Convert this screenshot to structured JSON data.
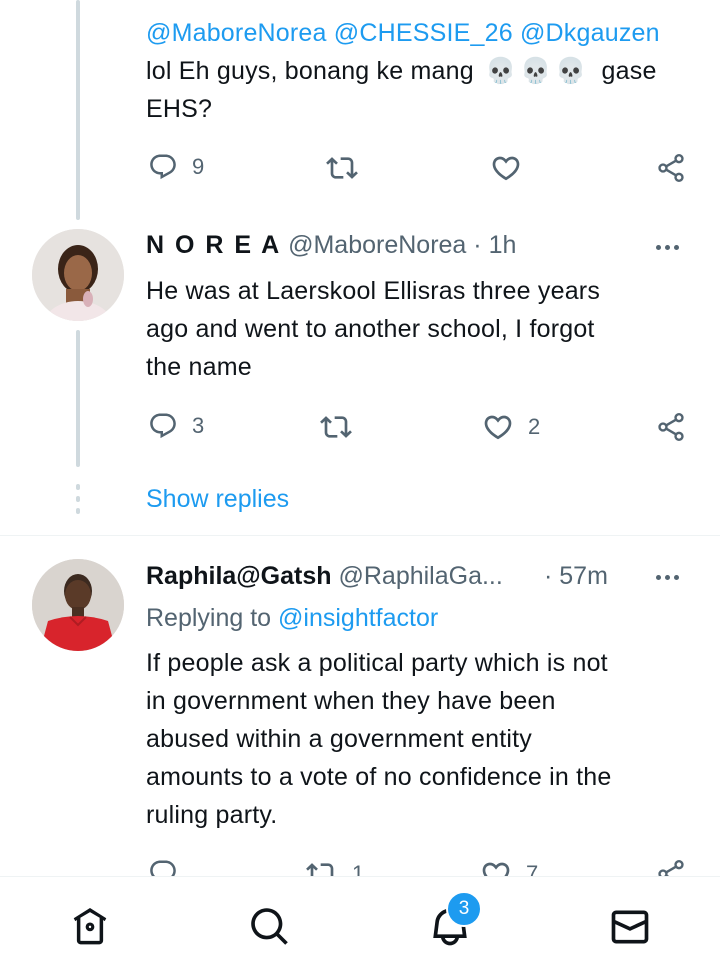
{
  "tweet1": {
    "mentions": "@MaboreNorea @CHESSIE_26 @Dkgauzen",
    "text_before": "lol Eh guys, bonang ke mang",
    "emojis": "💀💀💀",
    "text_after": "gase",
    "text_line3": "EHS?",
    "reply_count": "9"
  },
  "tweet2": {
    "display_name": "N O R E A",
    "handle": "@MaboreNorea",
    "time": "· 1h",
    "text_lines": [
      "He was at Laerskool Ellisras three years",
      "ago and went to another school, I forgot",
      "the name"
    ],
    "reply_count": "3",
    "like_count": "2"
  },
  "show_replies": "Show replies",
  "tweet3": {
    "display_name": "Raphila@Gatsh",
    "handle": "@RaphilaGa...",
    "time": "· 57m",
    "replying_prefix": "Replying to",
    "replying_to": "@insightfactor",
    "text_lines": [
      "If people ask a political party which is not",
      "in government when they have been",
      "abused within a government entity",
      "amounts to a vote of no confidence in the",
      "ruling party."
    ],
    "retweet_count": "1",
    "like_count": "7"
  },
  "nav": {
    "notifications_badge": "3",
    "items": [
      "home-icon",
      "search-icon",
      "notifications-icon",
      "messages-icon"
    ]
  },
  "colors": {
    "accent": "#1d9bf0",
    "muted": "#536471",
    "thread_line": "#cfd9de"
  }
}
